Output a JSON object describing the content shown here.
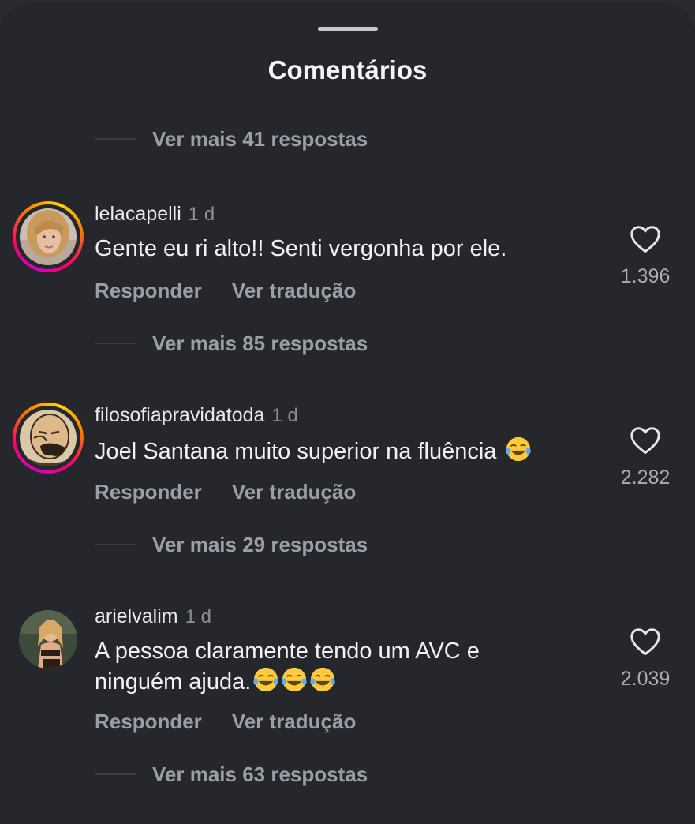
{
  "sheet": {
    "title": "Comentários"
  },
  "more_replies_top": "Ver mais 41 respostas",
  "comments": [
    {
      "username": "lelacapelli",
      "time": "1 d",
      "text": "Gente eu ri alto!! Senti vergonha por ele.",
      "reply_label": "Responder",
      "translate_label": "Ver tradução",
      "likes": "1.396",
      "more_replies": "Ver mais 85 respostas",
      "has_story_ring": true
    },
    {
      "username": "filosofiapravidatoda",
      "time": "1 d",
      "text": "Joel Santana muito superior na fluência",
      "reply_label": "Responder",
      "translate_label": "Ver tradução",
      "likes": "2.282",
      "more_replies": "Ver mais 29 respostas",
      "has_story_ring": true
    },
    {
      "username": "arielvalim",
      "time": "1 d",
      "text_line1": "A pessoa claramente tendo um AVC e",
      "text_line2": "ninguém ajuda.",
      "reply_label": "Responder",
      "translate_label": "Ver tradução",
      "likes": "2.039",
      "more_replies": "Ver mais 63 respostas",
      "has_story_ring": false
    }
  ],
  "icons": {
    "like": "heart-outline-icon",
    "emoji": "face-with-tears-of-joy-emoji"
  },
  "colors": {
    "background": "#25272c",
    "primary_text": "#f2f2f3",
    "secondary_text": "#9a9ea5",
    "story_ring_start": "#d300c5",
    "story_ring_end": "#ffd600"
  }
}
